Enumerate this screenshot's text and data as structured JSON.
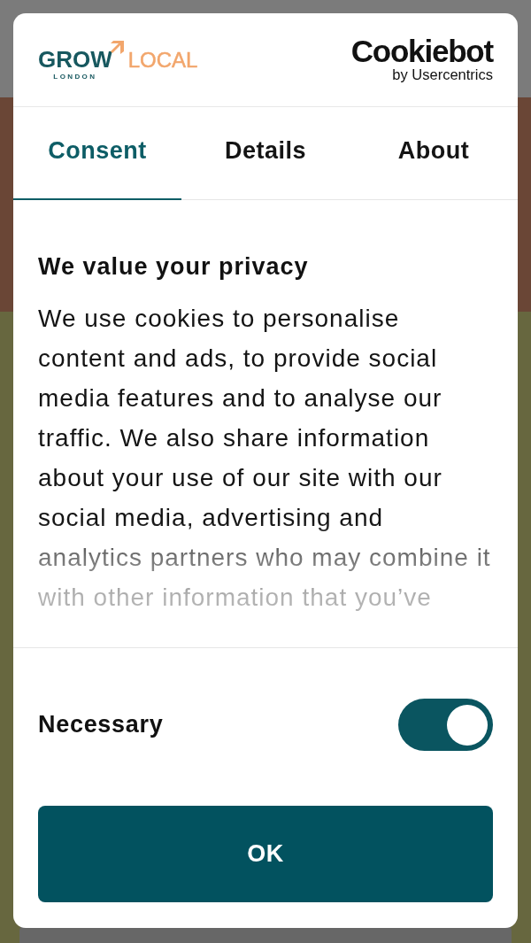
{
  "header": {
    "brand_logo": {
      "word_1": "GROW",
      "word_2": "LOCAL",
      "subtitle": "LONDON"
    },
    "provider_logo": {
      "name": "Cookiebot",
      "byline": "by Usercentrics"
    }
  },
  "tabs": [
    {
      "label": "Consent",
      "selected": true
    },
    {
      "label": "Details",
      "selected": false
    },
    {
      "label": "About",
      "selected": false
    }
  ],
  "consent": {
    "title": "We value your privacy",
    "body": "We use cookies to personalise content and ads, to provide social media features and to analyse our traffic. We also share information about your use of our site with our social media, advertising and analytics partners who may combine it with other information that you’ve"
  },
  "toggles": [
    {
      "label": "Necessary",
      "on": true
    }
  ],
  "buttons": [
    {
      "label": "OK"
    }
  ]
}
